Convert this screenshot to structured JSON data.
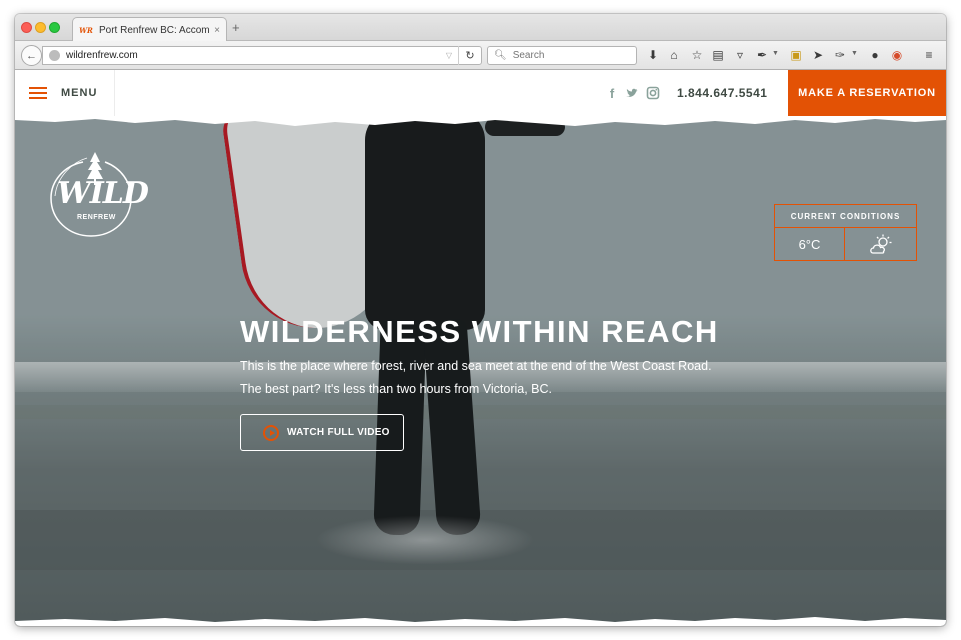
{
  "browser": {
    "tab_title": "Port Renfrew BC: Accomm...",
    "tab_favicon": "WR",
    "tab_close": "×",
    "new_tab": "+",
    "url": "wildrenfrew.com",
    "search_placeholder": "Search",
    "toolbar_icons": [
      "download-icon",
      "home-icon",
      "bookmark-star-icon",
      "reading-list-icon",
      "pocket-icon",
      "extension-icon",
      "notes-icon",
      "send-icon",
      "extension2-icon",
      "chat-icon",
      "chrome-color-icon",
      "hamburger-menu-icon"
    ]
  },
  "site": {
    "menu_label": "MENU",
    "social": [
      "facebook-icon",
      "twitter-icon",
      "instagram-icon"
    ],
    "phone": "1.844.647.5541",
    "reserve_label": "MAKE A RESERVATION",
    "logo_word": "WILD",
    "logo_sub": "RENFREW",
    "conditions": {
      "title": "CURRENT CONDITIONS",
      "temperature": "6°C",
      "weather_icon": "partly-cloudy-icon"
    },
    "hero": {
      "headline": "WILDERNESS WITHIN REACH",
      "line1": "This is the place where forest, river and sea meet at the end of the West Coast Road.",
      "line2": "The best part? It's less than two hours from Victoria, BC.",
      "video_label": "WATCH FULL VIDEO"
    }
  },
  "colors": {
    "accent": "#e35205",
    "header_text": "#3f4a43",
    "social": "#8aa29b"
  }
}
